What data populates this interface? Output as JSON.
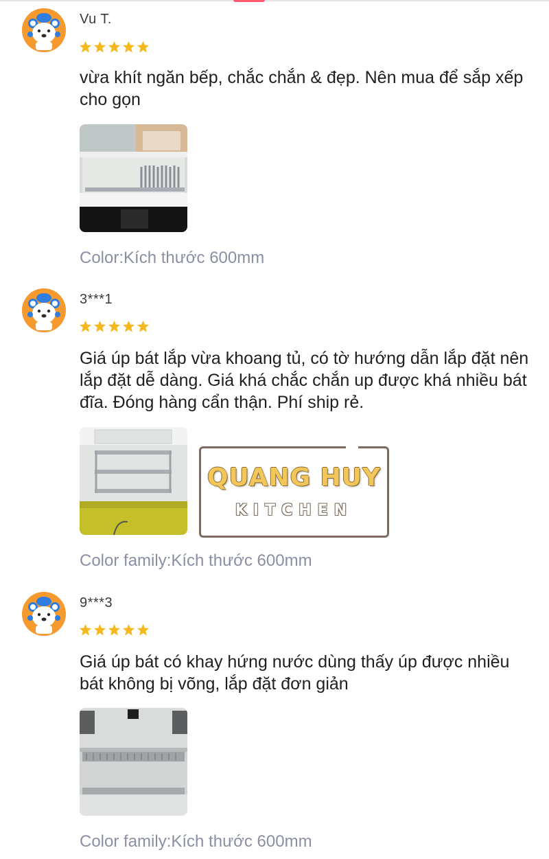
{
  "colors": {
    "star": "#f6b81f",
    "variant_text": "#8b8fa3",
    "avatar_bg": "#f59a2e"
  },
  "reviews": [
    {
      "username": "Vu T.",
      "rating": 5,
      "text": "vừa khít ngăn bếp, chắc chắn & đẹp. Nên mua để sắp xếp cho gọn",
      "variant": "Color:Kích thước 600mm"
    },
    {
      "username": "3***1",
      "rating": 5,
      "text": "Giá úp bát lắp vừa khoang tủ, có tờ hướng dẫn lắp đặt nên lắp đặt dễ dàng. Giá khá chắc chắn up được khá nhiều bát đĩa. Đóng hàng cẩn thận. Phí ship rẻ.",
      "variant": "Color family:Kích thước 600mm"
    },
    {
      "username": "9***3",
      "rating": 5,
      "text": "Giá úp bát có khay hứng nước dùng thấy úp được nhiều bát không bị võng, lắp đặt đơn giản",
      "variant": "Color family:Kích thước 600mm"
    }
  ],
  "brand": {
    "name": "QUANG HUY",
    "sub": "KITCHEN"
  }
}
